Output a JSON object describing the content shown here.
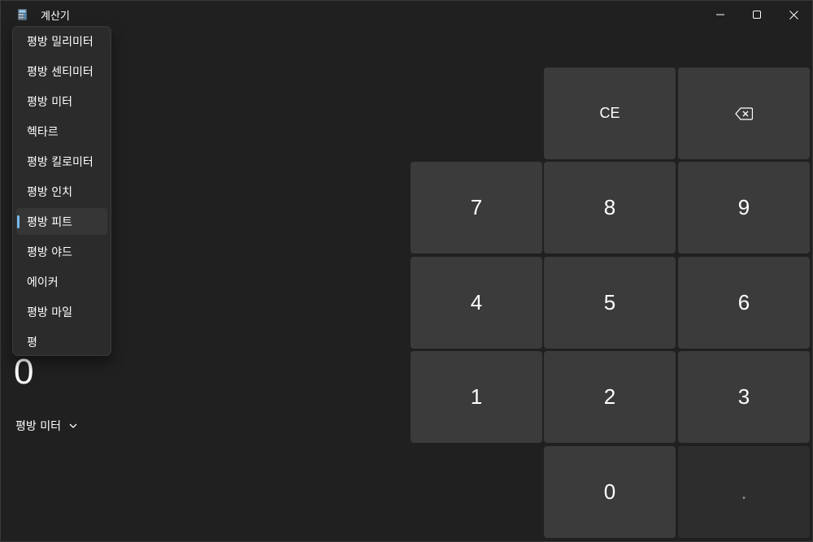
{
  "window": {
    "title": "계산기"
  },
  "dropdown": {
    "items": [
      "평방 밀리미터",
      "평방 센티미터",
      "평방 미터",
      "헥타르",
      "평방 킬로미터",
      "평방 인치",
      "평방 피트",
      "평방 야드",
      "에이커",
      "평방 마일",
      "평"
    ],
    "selected": "평방 피트"
  },
  "display": {
    "value": "0",
    "unit": "평방 미터"
  },
  "keypad": {
    "ce": "CE",
    "k7": "7",
    "k8": "8",
    "k9": "9",
    "k4": "4",
    "k5": "5",
    "k6": "6",
    "k1": "1",
    "k2": "2",
    "k3": "3",
    "k0": "0",
    "decimal": "."
  },
  "colors": {
    "accent": "#76b9ed",
    "background": "#202020",
    "key": "#3b3b3b"
  }
}
